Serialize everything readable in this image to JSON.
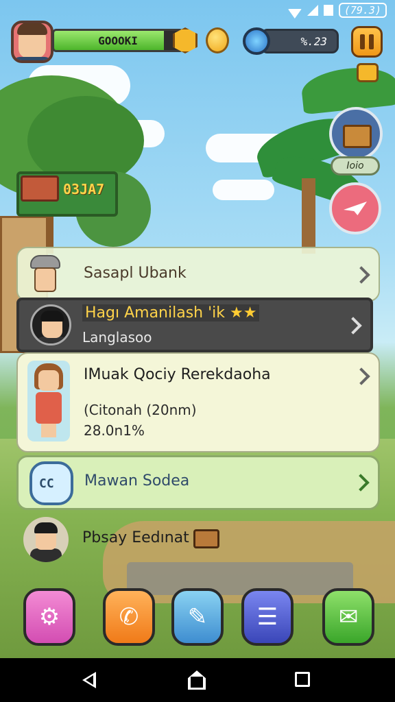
{
  "statusbar": {
    "time": "(79.3)"
  },
  "hud": {
    "xp_label": "GOOOKI",
    "gem_label": "%.23"
  },
  "sign": {
    "text": "03JA7"
  },
  "side": {
    "chest_label": "Ioio"
  },
  "list": [
    {
      "title": "Sasapl Ubank"
    },
    {
      "title": "Hagı Amanilash 'ik",
      "stars": "★★",
      "subtitle": "Langlasoo"
    },
    {
      "title": "IMuak Qociy Rerekdaoha",
      "subtitle": "(Citonah (20nm)",
      "detail": "28.0n1%"
    },
    {
      "title": "Mawan Sodea",
      "icon_text": "CC"
    },
    {
      "title": "Pbsay Eedınat"
    }
  ],
  "dock": [
    "settings",
    "phone",
    "tools",
    "notes",
    "chat"
  ],
  "colors": {
    "accent_green": "#4db52b",
    "card_highlight": "#4a4a4a",
    "title_yellow": "#ffd34a"
  }
}
